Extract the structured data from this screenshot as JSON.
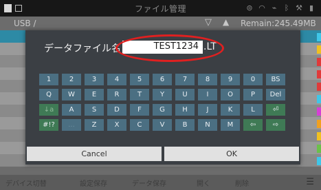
{
  "titlebar": {
    "title": "ファイル管理",
    "icons": [
      "cast-icon",
      "wifi-icon",
      "usb-icon",
      "bluetooth-icon",
      "wrench-icon",
      "battery-icon"
    ]
  },
  "pathbar": {
    "path": "USB /",
    "remain": "Remain:245.49MB"
  },
  "dialog": {
    "label": "データファイル名",
    "filename": "TEST1234",
    "extension": ".LT",
    "cancel_label": "Cancel",
    "ok_label": "OK"
  },
  "keyboard": {
    "row1": [
      "1",
      "2",
      "3",
      "4",
      "5",
      "6",
      "7",
      "8",
      "9",
      "0",
      "BS"
    ],
    "row2": [
      "Q",
      "W",
      "E",
      "R",
      "T",
      "Y",
      "U",
      "I",
      "O",
      "P",
      "Del"
    ],
    "row3": [
      "↓a",
      "A",
      "S",
      "D",
      "F",
      "G",
      "H",
      "J",
      "K",
      "L",
      "⏎"
    ],
    "row4": [
      "#!?",
      "...",
      "Z",
      "X",
      "C",
      "V",
      "B",
      "N",
      "M",
      "⇦",
      "⇨"
    ]
  },
  "bottombar": {
    "buttons": [
      "デバイス切替",
      "設定保存",
      "データ保存",
      "開く",
      "削除"
    ]
  },
  "colors": {
    "accent_ring": "#e02020",
    "key_blue": "#4b6f82",
    "key_green": "#3f7a55",
    "dialog_bg": "#3b3f44"
  }
}
